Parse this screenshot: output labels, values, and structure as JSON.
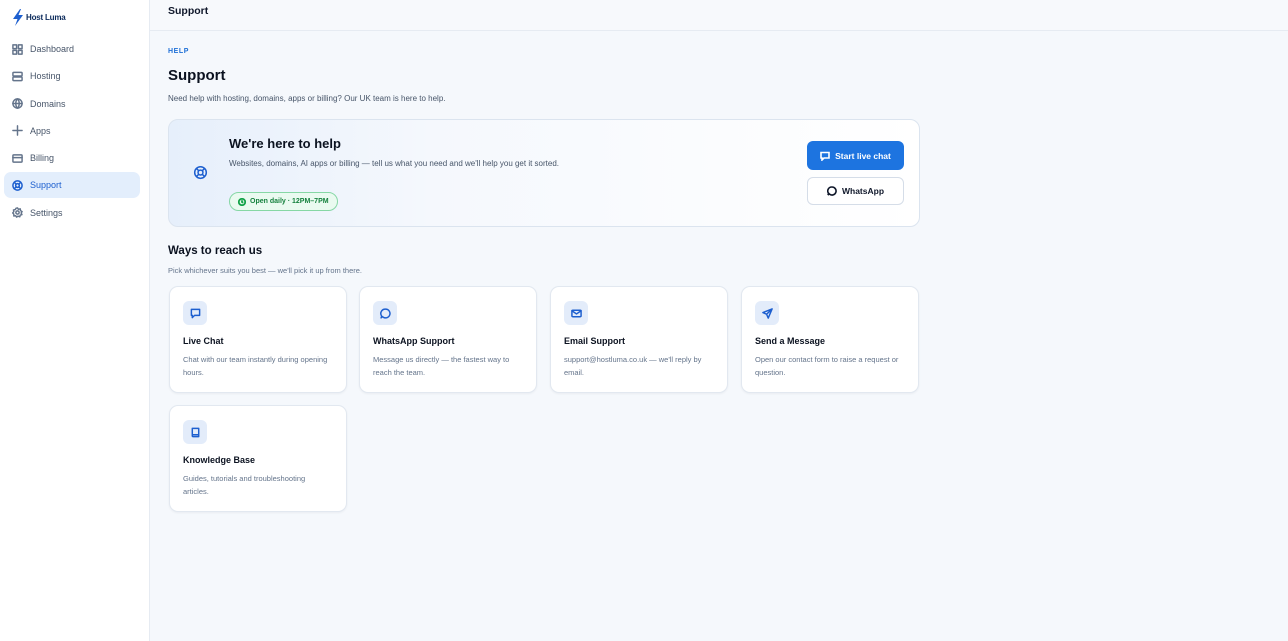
{
  "brand": {
    "name": "Host Luma"
  },
  "sidebar": {
    "items": [
      {
        "label": "Dashboard",
        "icon": "grid-icon",
        "active": false
      },
      {
        "label": "Hosting",
        "icon": "server-icon",
        "active": false
      },
      {
        "label": "Domains",
        "icon": "globe-icon",
        "active": false
      },
      {
        "label": "Apps",
        "icon": "plus-icon",
        "active": false
      },
      {
        "label": "Billing",
        "icon": "credit-card-icon",
        "active": false
      },
      {
        "label": "Support",
        "icon": "lifebuoy-icon",
        "active": true
      },
      {
        "label": "Settings",
        "icon": "gear-icon",
        "active": false
      }
    ]
  },
  "topbar": {
    "title": "Support"
  },
  "page": {
    "eyebrow": "HELP",
    "title": "Support",
    "subtitle": "Need help with hosting, domains, apps or billing? Our UK team is here to help."
  },
  "hero": {
    "title": "We're here to help",
    "description": "Websites, domains, AI apps or billing — tell us what you need and we'll help you get it sorted.",
    "hours": "Open daily · 12PM–7PM",
    "primary_button": "Start live chat",
    "secondary_button": "WhatsApp"
  },
  "ways": {
    "title": "Ways to reach us",
    "subtitle": "Pick whichever suits you best — we'll pick it up from there.",
    "cards": [
      {
        "title": "Live Chat",
        "description": "Chat with our team instantly during opening hours.",
        "icon": "chat-icon"
      },
      {
        "title": "WhatsApp Support",
        "description": "Message us directly — the fastest way to reach the team.",
        "icon": "whatsapp-icon"
      },
      {
        "title": "Email Support",
        "description": "support@hostluma.co.uk — we'll reply by email.",
        "icon": "mail-icon"
      },
      {
        "title": "Send a Message",
        "description": "Open our contact form to raise a request or question.",
        "icon": "send-icon"
      },
      {
        "title": "Knowledge Base",
        "description": "Guides, tutorials and troubleshooting articles.",
        "icon": "book-icon"
      }
    ]
  },
  "colors": {
    "accent": "#1d74e0",
    "active_bg": "#e3eefc",
    "success": "#15a34a"
  }
}
